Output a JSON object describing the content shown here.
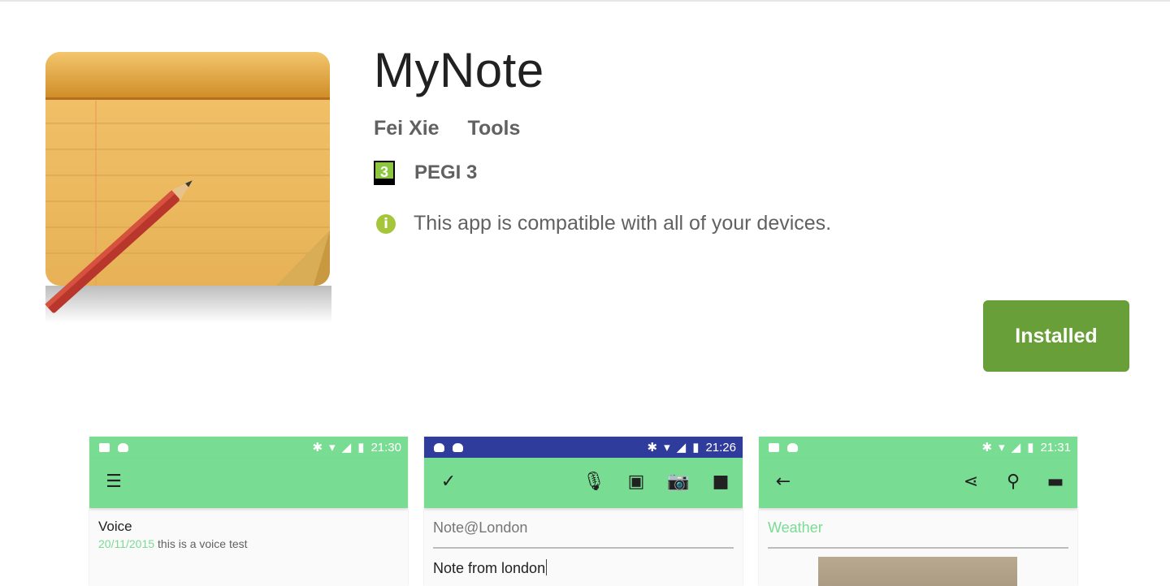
{
  "app": {
    "title": "MyNote",
    "developer": "Fei Xie",
    "category": "Tools",
    "rating_badge": "3",
    "rating_label": "PEGI 3",
    "compatibility": "This app is compatible with all of your devices.",
    "install_button": "Installed",
    "accent_color": "#689f38"
  },
  "screenshots": [
    {
      "time": "21:30",
      "status_color": "#79dc93",
      "appbar_color": "#79dc93",
      "note_title": "Voice",
      "note_date": "20/11/2015",
      "note_text": "this is a voice test"
    },
    {
      "time": "21:26",
      "status_color": "#2f3c9c",
      "appbar_color": "#79dc93",
      "title_hint": "Note@London",
      "body_text": "Note from london"
    },
    {
      "time": "21:31",
      "status_color": "#79dc93",
      "appbar_color": "#79dc93",
      "title_hint": "Weather"
    }
  ]
}
